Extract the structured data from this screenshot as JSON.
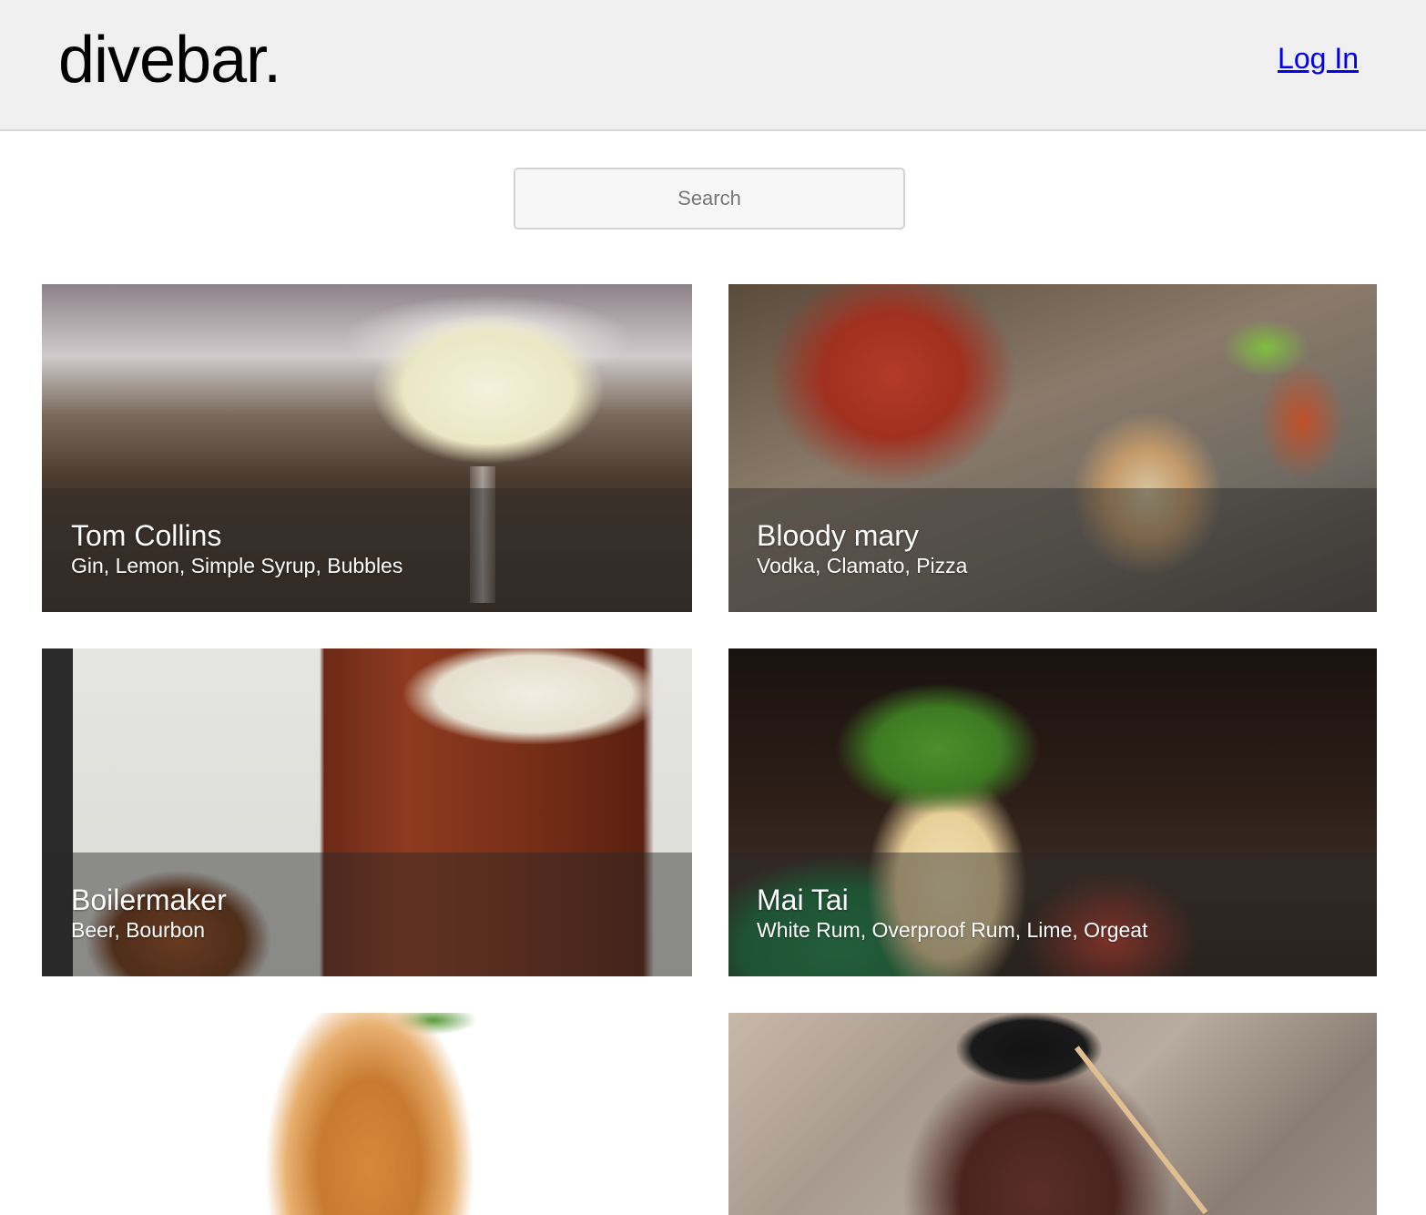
{
  "header": {
    "logo": "divebar.",
    "login_label": "Log In"
  },
  "search": {
    "placeholder": "Search",
    "value": ""
  },
  "drinks": [
    {
      "name": "Tom Collins",
      "ingredients": "Gin, Lemon, Simple Syrup, Bubbles"
    },
    {
      "name": "Bloody mary",
      "ingredients": "Vodka, Clamato, Pizza"
    },
    {
      "name": "Boilermaker",
      "ingredients": "Beer, Bourbon"
    },
    {
      "name": "Mai Tai",
      "ingredients": "White Rum, Overproof Rum, Lime, Orgeat"
    }
  ]
}
